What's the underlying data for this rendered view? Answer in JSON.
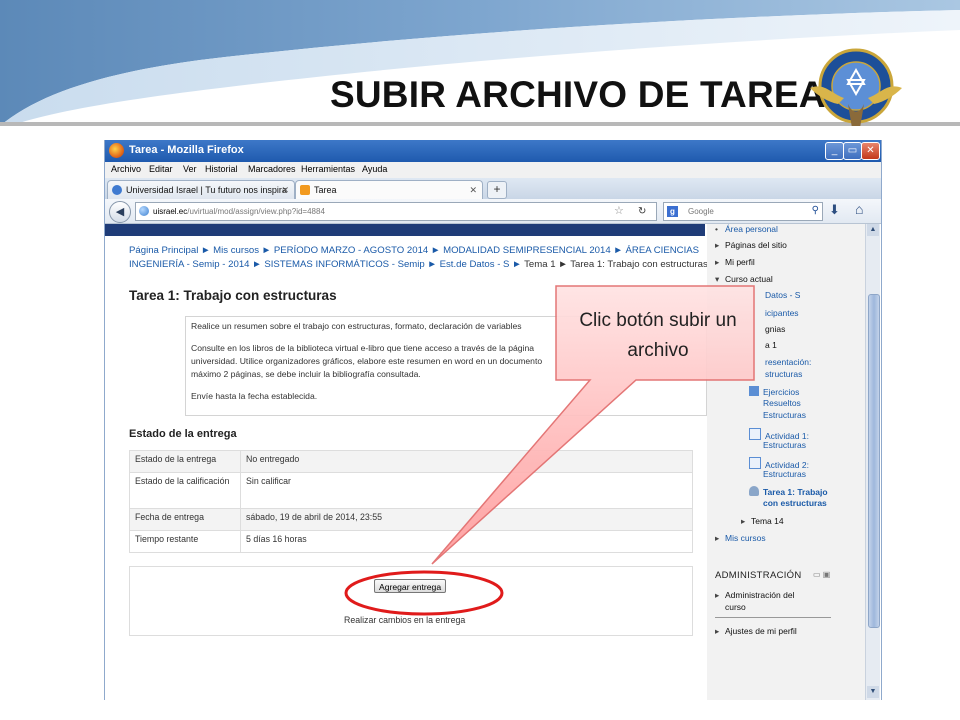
{
  "slide": {
    "title": "SUBIR ARCHIVO DE TAREA",
    "logo_text": "UNIVERSIDAD ISRAEL"
  },
  "browser": {
    "window_title": "Tarea - Mozilla Firefox",
    "window_buttons": [
      "_",
      "▭",
      "✕"
    ],
    "menu": [
      "Archivo",
      "Editar",
      "Ver",
      "Historial",
      "Marcadores",
      "Herramientas",
      "Ayuda"
    ],
    "tabs": [
      {
        "label": "Universidad Israel | Tu futuro nos inspira",
        "active": false
      },
      {
        "label": "Tarea",
        "active": true
      }
    ],
    "new_tab_label": "+",
    "url_domain": "uisrael.ec",
    "url_path": "/uvirtual/mod/assign/view.php?id=4884",
    "search_placeholder": "Google"
  },
  "page": {
    "breadcrumb_line1": "Página Principal ► Mis cursos ► PERÍODO MARZO - AGOSTO 2014 ► MODALIDAD SEMIPRESENCIAL 2014 ► ÁREA CIENCIAS",
    "breadcrumb_line2_links": "INGENIERÍA - Semip - 2014 ► SISTEMAS INFORMÁTICOS - Semip ► Est.de Datos - S ►",
    "breadcrumb_line2_current": "Tema 1 ► Tarea 1: Trabajo con estructuras",
    "assignment_title": "Tarea 1: Trabajo con estructuras",
    "intro": [
      "Realice un resumen sobre el trabajo con estructuras, formato, declaración de variables",
      "Consulte en los libros de la biblioteca virtual e-libro que tiene acceso a través de la página",
      "universidad. Utilice organizadores gráficos, elabore este resumen en word en un documento",
      "máximo 2 páginas, se debe incluir la bibliografía consultada.",
      "Envíe hasta la fecha establecida."
    ],
    "status_heading": "Estado de la entrega",
    "status_rows": [
      {
        "label": "Estado de la entrega",
        "value": "No entregado"
      },
      {
        "label": "Estado de la calificación",
        "value": "Sin calificar"
      },
      {
        "label": "Fecha de entrega",
        "value": "sábado, 19 de abril de 2014, 23:55"
      },
      {
        "label": "Tiempo restante",
        "value": "5 días 16 horas"
      }
    ],
    "add_submission_button": "Agregar entrega",
    "submit_note": "Realizar cambios en la entrega"
  },
  "sidebar": {
    "items": [
      "Área personal",
      "Páginas del sitio",
      "Mi perfil",
      "Curso actual",
      "Datos - S",
      "icipantes",
      "gnias",
      "a 1",
      "resentación:",
      "structuras",
      "Ejercicios",
      "Resueltos",
      "Estructuras",
      "Actividad 1:",
      "Estructuras",
      "Actividad 2:",
      "Estructuras",
      "Tarea 1: Trabajo",
      "con estructuras",
      "Tema 14",
      "Mis cursos"
    ],
    "admin_heading": "ADMINISTRACIÓN",
    "admin_items": [
      "Administración del",
      "curso",
      "Ajustes de mi perfil"
    ]
  },
  "callout": {
    "line1": "Clic botón subir un",
    "line2": "archivo"
  }
}
